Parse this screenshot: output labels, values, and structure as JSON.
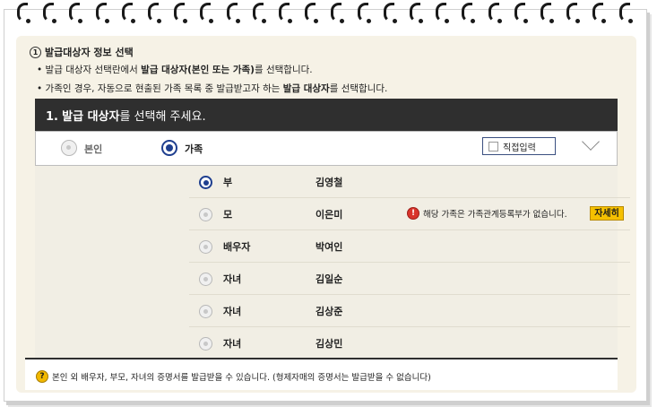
{
  "step": {
    "number": "1",
    "title": "발급대상자 정보 선택"
  },
  "bullets": [
    {
      "pre": "• 발급 대상자 선택란에서 ",
      "bold": "발급 대상자(본인 또는 가족)",
      "post": "를 선택합니다."
    },
    {
      "pre": "• 가족인 경우, 자동으로 현출된 가족 목록 중 발급받고자 하는 ",
      "bold": "발급 대상자",
      "post": "를 선택합니다."
    }
  ],
  "panel": {
    "number": "1.",
    "bold": "발급 대상자",
    "rest": "를 선택해 주세요."
  },
  "options": {
    "self_label": "본인",
    "family_label": "가족",
    "selected": "가족",
    "direct_input_label": "직접입력"
  },
  "family_rows": [
    {
      "relation": "부",
      "name": "김영철",
      "selected": true
    },
    {
      "relation": "모",
      "name": "이은미",
      "selected": false,
      "warning": "해당 가족은 가족관계등록부가 없습니다.",
      "detail_label": "자세히"
    },
    {
      "relation": "배우자",
      "name": "박여인",
      "selected": false
    },
    {
      "relation": "자녀",
      "name": "김일순",
      "selected": false
    },
    {
      "relation": "자녀",
      "name": "김상준",
      "selected": false
    },
    {
      "relation": "자녀",
      "name": "김상민",
      "selected": false
    }
  ],
  "footnote": {
    "icon": "?",
    "text": "본인 외 배우자, 부모, 자녀의 증명서를 발급받을 수 있습니다. (형제자매의 증명서는 발급받을 수 없습니다)"
  },
  "icons": {
    "warning": "!",
    "binder_rings": "ring-icon"
  },
  "colors": {
    "header_bg": "#2f2f2f",
    "accent_blue": "#1f3f8f",
    "detail_button": "#f5c000",
    "warning_red": "#d9342b",
    "paper_bg": "#f6f2e6"
  }
}
